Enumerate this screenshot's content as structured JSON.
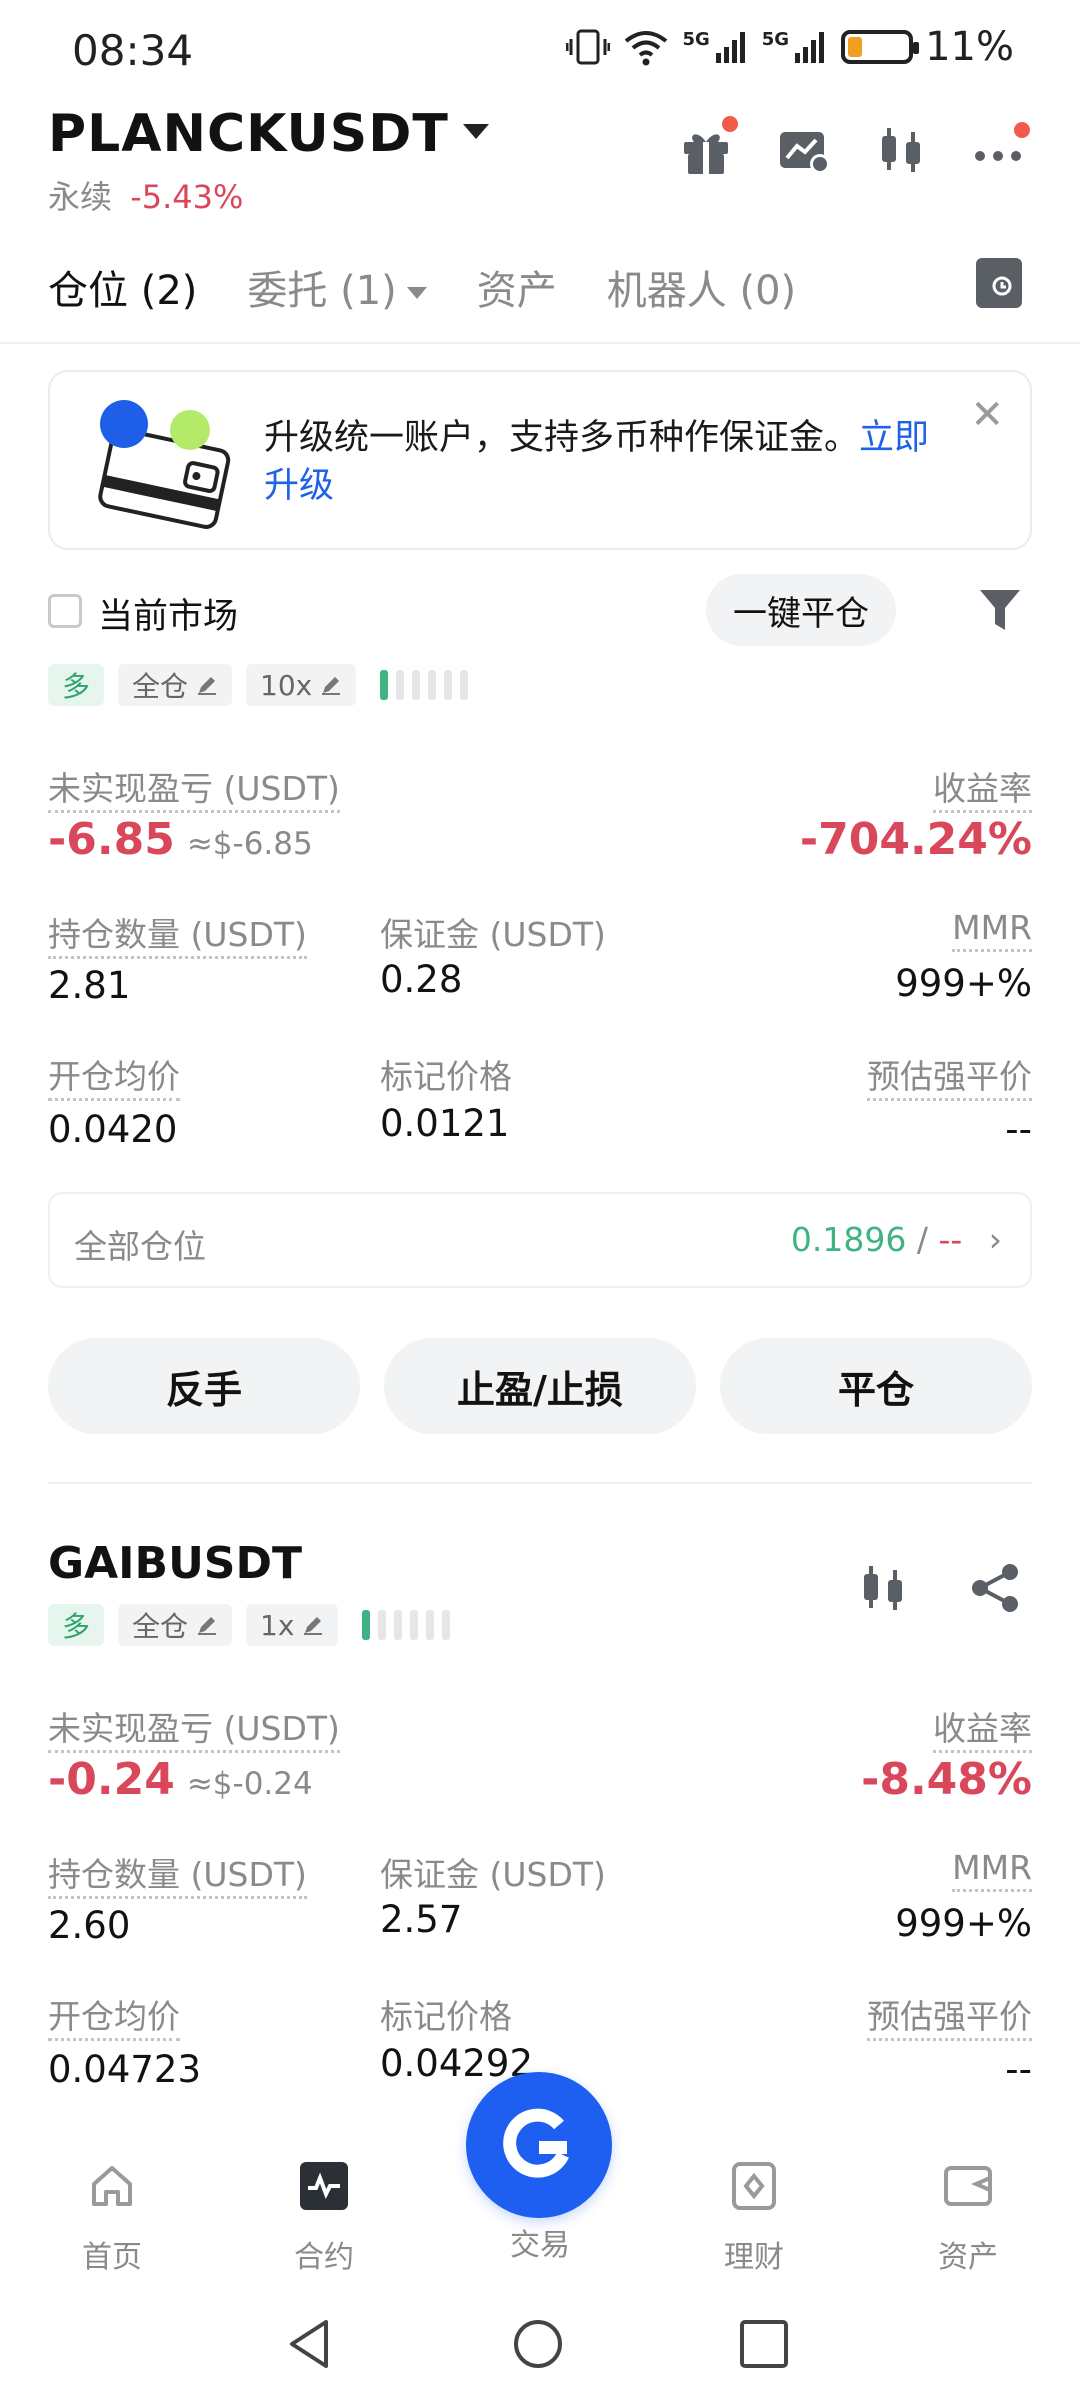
{
  "status_bar": {
    "time": "08:34",
    "net1": "5G",
    "net2": "5G",
    "battery": "11%"
  },
  "header": {
    "symbol": "PLANCKUSDT",
    "contract_type": "永续",
    "change": "-5.43%"
  },
  "tabs": [
    {
      "label": "仓位 (2)"
    },
    {
      "label": "委托 (1)"
    },
    {
      "label": "资产"
    },
    {
      "label": "机器人 (0)"
    }
  ],
  "banner": {
    "text": "升级统一账户，支持多币种作保证金。",
    "link": "立即升级"
  },
  "filter": {
    "current_market": "当前市场",
    "close_all": "一键平仓"
  },
  "positions": [
    {
      "direction": "多",
      "margin_mode": "全仓",
      "leverage": "10x",
      "unrealized_label": "未实现盈亏 (USDT)",
      "unrealized": "-6.85",
      "unrealized_usd": "≈$-6.85",
      "roe_label": "收益率",
      "roe": "-704.24%",
      "size_label": "持仓数量 (USDT)",
      "size": "2.81",
      "margin_label": "保证金 (USDT)",
      "margin": "0.28",
      "mmr_label": "MMR",
      "mmr": "999+%",
      "entry_label": "开仓均价",
      "entry": "0.0420",
      "mark_label": "标记价格",
      "mark": "0.0121",
      "liq_label": "预估强平价",
      "liq": "--",
      "all_positions_label": "全部仓位",
      "all_positions_value": "0.1896",
      "all_positions_sep": "/",
      "all_positions_dash": "--",
      "actions": [
        "反手",
        "止盈/止损",
        "平仓"
      ]
    },
    {
      "symbol": "GAIBUSDT",
      "direction": "多",
      "margin_mode": "全仓",
      "leverage": "1x",
      "unrealized_label": "未实现盈亏 (USDT)",
      "unrealized": "-0.24",
      "unrealized_usd": "≈$-0.24",
      "roe_label": "收益率",
      "roe": "-8.48%",
      "size_label": "持仓数量 (USDT)",
      "size": "2.60",
      "margin_label": "保证金 (USDT)",
      "margin": "2.57",
      "mmr_label": "MMR",
      "mmr": "999+%",
      "entry_label": "开仓均价",
      "entry": "0.04723",
      "mark_label": "标记价格",
      "mark": "0.04292",
      "liq_label": "预估强平价",
      "liq": "--"
    }
  ],
  "bottom_nav": [
    {
      "label": "首页",
      "icon": "home-icon"
    },
    {
      "label": "合约",
      "icon": "futures-icon"
    },
    {
      "label": "交易",
      "icon": "trade-icon"
    },
    {
      "label": "理财",
      "icon": "earn-icon"
    },
    {
      "label": "资产",
      "icon": "wallet-icon"
    }
  ],
  "colors": {
    "red": "#d9485a",
    "green": "#3fb482",
    "blue": "#1e63e6",
    "fab": "#1e5ef0"
  }
}
